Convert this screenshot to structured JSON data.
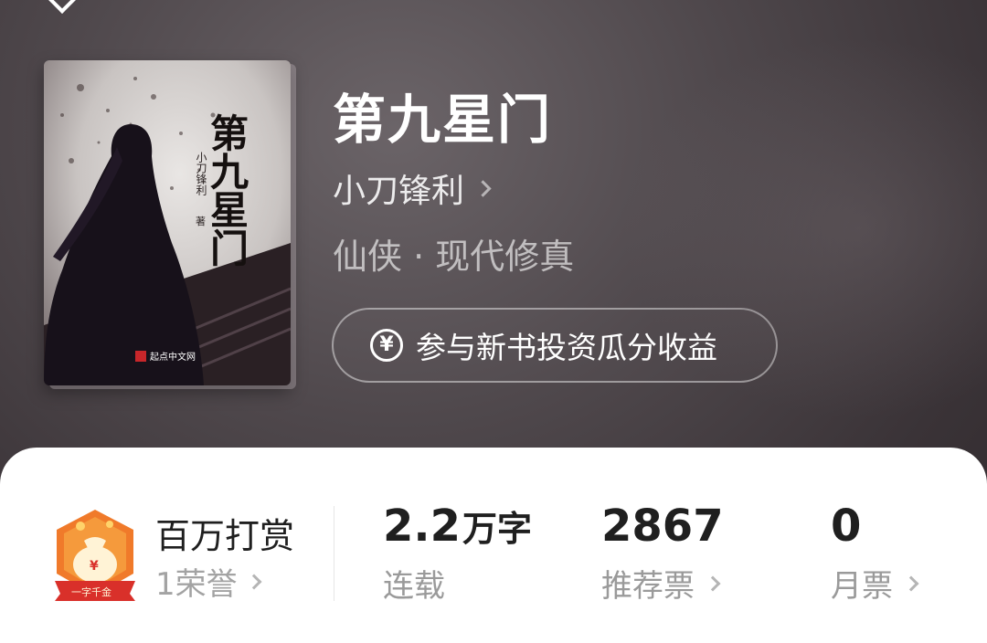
{
  "book": {
    "title": "第九星门",
    "author": "小刀锋利",
    "genre": "仙侠 · 现代修真",
    "invest_label": "参与新书投资瓜分收益",
    "invest_icon": "yen-circle-icon",
    "cover": {
      "title_text": "第九星门",
      "author_text": "小刀锋利",
      "author_suffix": "著",
      "publisher": "起点中文网"
    }
  },
  "stats": {
    "reward": {
      "title": "百万打赏",
      "honor": "1荣誉",
      "badge_text": "一字千金",
      "badge_icon": "money-bag-badge-icon"
    },
    "words": {
      "value": "2.2",
      "unit": "万字",
      "label": "连载"
    },
    "recommend": {
      "value": "2867",
      "label": "推荐票"
    },
    "monthly": {
      "value": "0",
      "label": "月票"
    }
  },
  "colors": {
    "header_bg": "#4f484c",
    "card_bg": "#ffffff",
    "badge_orange": "#f07a2a",
    "badge_red": "#d9302a"
  }
}
